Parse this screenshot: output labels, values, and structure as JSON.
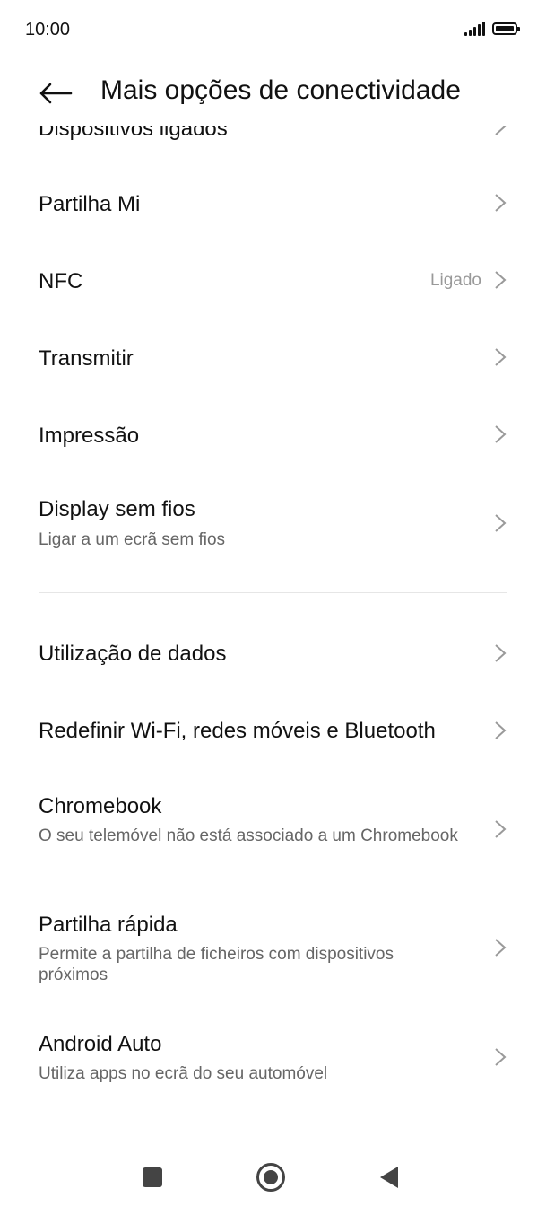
{
  "status_bar": {
    "time": "10:00",
    "icons": [
      "signal-icon",
      "battery-icon"
    ]
  },
  "header": {
    "title": "Mais opções de conectividade",
    "back_icon": "arrow-left-icon"
  },
  "items": [
    {
      "title": "Dispositivos ligados",
      "subtitle": "",
      "value": ""
    },
    {
      "title": "Partilha Mi",
      "subtitle": "",
      "value": ""
    },
    {
      "title": "NFC",
      "subtitle": "",
      "value": "Ligado"
    },
    {
      "title": "Transmitir",
      "subtitle": "",
      "value": ""
    },
    {
      "title": "Impressão",
      "subtitle": "",
      "value": ""
    },
    {
      "title": "Display sem fios",
      "subtitle": "Ligar a um ecrã sem fios",
      "value": ""
    },
    {
      "title": "Utilização de dados",
      "subtitle": "",
      "value": ""
    },
    {
      "title": "Redefinir Wi-Fi, redes móveis e Bluetooth",
      "subtitle": "",
      "value": ""
    },
    {
      "title": "Chromebook",
      "subtitle": "O seu telemóvel não está associado a um Chromebook",
      "value": ""
    },
    {
      "title": "Partilha rápida",
      "subtitle": "Permite a partilha de ficheiros com dispositivos próximos",
      "value": ""
    },
    {
      "title": "Android Auto",
      "subtitle": "Utiliza apps no ecrã do seu automóvel",
      "value": ""
    }
  ],
  "nav_bar": {
    "icons": [
      "recents-square-icon",
      "home-circle-icon",
      "back-triangle-icon"
    ]
  },
  "colors": {
    "text": "#111111",
    "secondary": "#666666",
    "value": "#999999",
    "chevron": "#9a9a9a",
    "divider": "#e6e6e6"
  }
}
